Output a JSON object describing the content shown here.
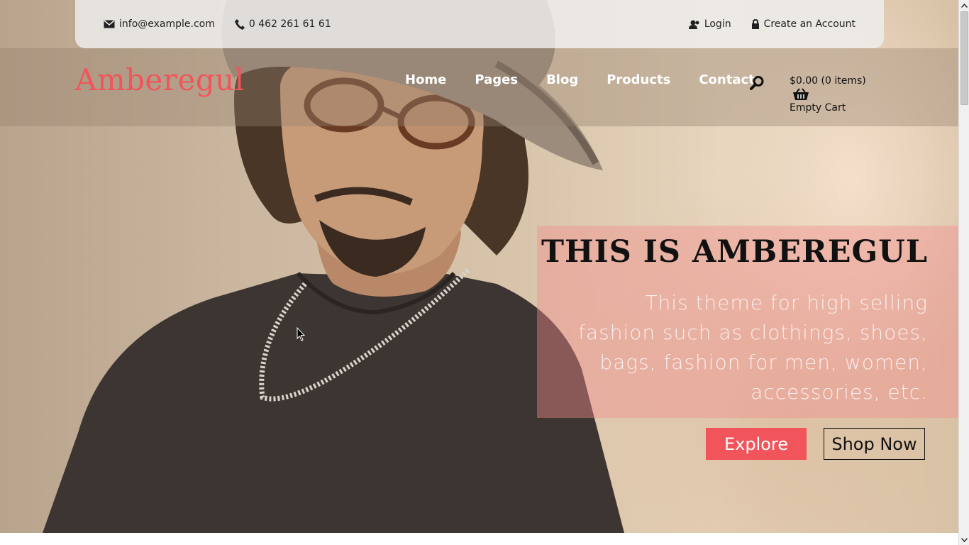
{
  "topbar": {
    "email": "info@example.com",
    "phone": "0 462 261 61 61",
    "login": "Login",
    "create_account": "Create an Account"
  },
  "header": {
    "logo": "Amberegul",
    "nav": [
      {
        "label": "Home"
      },
      {
        "label": "Pages"
      },
      {
        "label": "Blog"
      },
      {
        "label": "Products"
      },
      {
        "label": "Contact"
      }
    ],
    "search_icon": "search-icon",
    "cart": {
      "total": "$0.00 (0 items)",
      "status": "Empty Cart",
      "icon": "basket-icon"
    }
  },
  "hero": {
    "title": "THIS IS AMBEREGUL",
    "text": "This theme for high selling fashion such as clothings, shoes, bags, fashion for men, women, accessories, etc.",
    "explore": "Explore",
    "shop_now": "Shop Now"
  },
  "colors": {
    "accent": "#f2545b",
    "caption_overlay": "#f28c8c",
    "nav_text": "#ffffff"
  }
}
